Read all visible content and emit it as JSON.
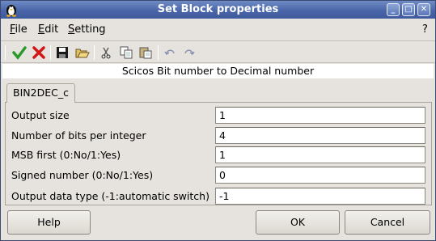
{
  "window": {
    "title": "Set Block properties"
  },
  "menubar": {
    "file": "File",
    "edit": "Edit",
    "setting": "Setting",
    "help": "?"
  },
  "description": "Scicos Bit number to  Decimal number",
  "tab": {
    "label": "BIN2DEC_c"
  },
  "fields": [
    {
      "label": "Output size",
      "value": "1"
    },
    {
      "label": "Number of bits per integer",
      "value": "4"
    },
    {
      "label": "MSB first (0:No/1:Yes)",
      "value": "1"
    },
    {
      "label": "Signed number (0:No/1:Yes)",
      "value": "0"
    },
    {
      "label": "Output data type (-1:automatic switch)",
      "value": "-1"
    }
  ],
  "buttons": {
    "help": "Help",
    "ok": "OK",
    "cancel": "Cancel"
  },
  "toolbar": [
    "ok-check-icon",
    "cancel-x-icon",
    "save-icon",
    "open-icon",
    "cut-icon",
    "copy-icon",
    "paste-icon",
    "undo-icon",
    "redo-icon"
  ]
}
